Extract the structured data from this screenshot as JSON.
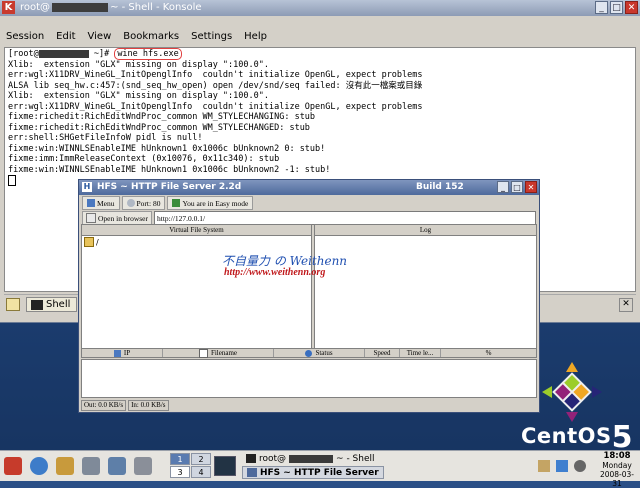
{
  "konsole": {
    "title_prefix": "root@",
    "title_suffix": "~ - Shell - Konsole",
    "menu": [
      "Session",
      "Edit",
      "View",
      "Bookmarks",
      "Settings",
      "Help"
    ],
    "prompt_prefix": "[root@",
    "prompt_suffix": " ~]# ",
    "command": "wine hfs.exe",
    "lines": [
      "Xlib:  extension \"GLX\" missing on display \":100.0\".",
      "err:wgl:X11DRV_WineGL_InitOpenglInfo  couldn't initialize OpenGL, expect problems",
      "ALSA lib seq_hw.c:457:(snd_seq_hw_open) open /dev/snd/seq failed: 沒有此一檔案或目錄",
      "Xlib:  extension \"GLX\" missing on display \":100.0\".",
      "err:wgl:X11DRV_WineGL_InitOpenglInfo  couldn't initialize OpenGL, expect problems",
      "fixme:richedit:RichEditWndProc_common WM_STYLECHANGING: stub",
      "fixme:richedit:RichEditWndProc_common WM_STYLECHANGED: stub",
      "err:shell:SHGetFileInfoW pidl is null!",
      "fixme:win:WINNLSEnableIME hUnknown1 0x1006c bUnknown2 0: stub!",
      "fixme:imm:ImmReleaseContext (0x10076, 0x11c340): stub",
      "fixme:win:WINNLSEnableIME hUnknown1 0x1006c bUnknown2 -1: stub!"
    ],
    "tab_label": "Shell"
  },
  "hfs": {
    "title": "HFS ~ HTTP File Server 2.2d",
    "build": "Build 152",
    "toolbar": {
      "menu": "Menu",
      "port": "Port: 80",
      "mode": "You are in Easy mode"
    },
    "open_in_browser": "Open in browser",
    "url": "http://127.0.0.1/",
    "vfs_header": "Virtual File System",
    "vfs_root": "/",
    "log_header": "Log",
    "columns": [
      "IP",
      "Filename",
      "Status",
      "Speed",
      "Time le...",
      "%"
    ],
    "status_out": "Out: 0.0 KB/s",
    "status_in": "In: 0.0 KB/s"
  },
  "watermark": {
    "line1": "不自量力 の Weithenn",
    "line2": "http://www.weithenn.org"
  },
  "desktop": {
    "brand": "CentOS",
    "brand_version": "5"
  },
  "taskbar": {
    "pager": [
      "1",
      "2",
      "3",
      "4"
    ],
    "task1_prefix": "root@",
    "task1_suffix": "~ - Shell",
    "task2": "HFS ~ HTTP File Server",
    "clock_time": "18:08",
    "clock_day": "Monday",
    "clock_date": "2008-03-31"
  },
  "colors": {
    "desktop": "#1d3f73",
    "konsole_title": "#8d9bb5",
    "hfs_title": "#4e6a9c",
    "watermark_blue": "#1f4fb0",
    "watermark_red": "#c0181b",
    "highlight_red": "#e04040"
  }
}
